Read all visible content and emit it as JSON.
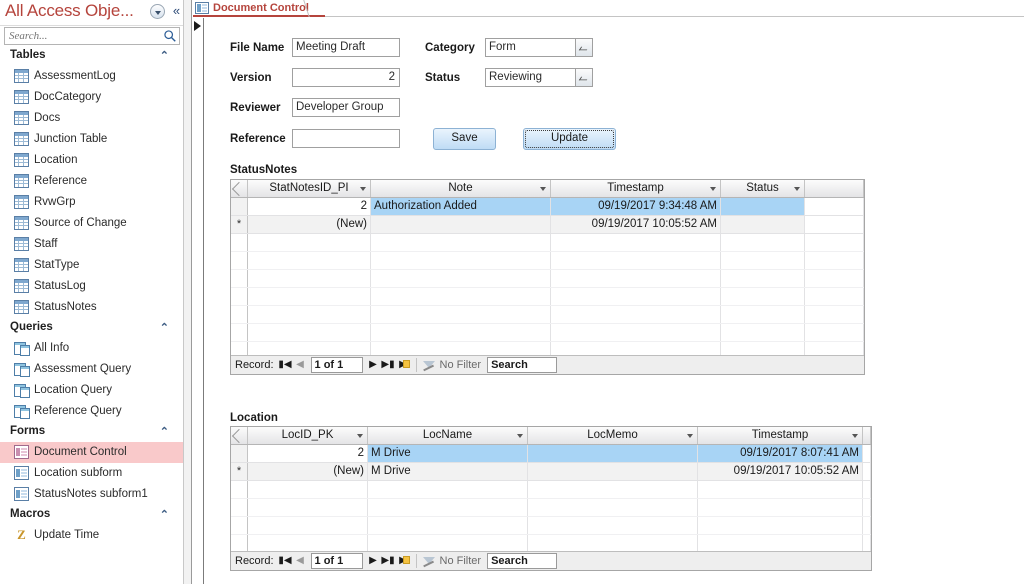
{
  "nav_pane": {
    "title": "All Access Obje...",
    "dropdown_icon": "chevron-down-circle-icon",
    "collapse_icon": "double-chevron-left-icon",
    "search_placeholder": "Search...",
    "search_value": "",
    "search_icon": "magnifier-icon",
    "groups": [
      {
        "label": "Tables",
        "collapse_icon": "chevron-up-icon",
        "icon_type": "table",
        "items": [
          "AssessmentLog",
          "DocCategory",
          "Docs",
          "Junction Table",
          "Location",
          "Reference",
          "RvwGrp",
          "Source of Change",
          "Staff",
          "StatType",
          "StatusLog",
          "StatusNotes"
        ]
      },
      {
        "label": "Queries",
        "collapse_icon": "chevron-up-icon",
        "icon_type": "query",
        "items": [
          "All Info",
          "Assessment Query",
          "Location Query",
          "Reference Query"
        ]
      },
      {
        "label": "Forms",
        "collapse_icon": "chevron-up-icon",
        "icon_type": "form",
        "items": [
          "Document Control",
          "Location subform",
          "StatusNotes subform1"
        ],
        "selected": "Document Control"
      },
      {
        "label": "Macros",
        "collapse_icon": "chevron-up-icon",
        "icon_type": "macro",
        "items": [
          "Update Time"
        ]
      }
    ]
  },
  "tab": {
    "label": "Document Control",
    "icon": "form-icon"
  },
  "form": {
    "fields": {
      "file_name_label": "File Name",
      "file_name_value": "Meeting Draft",
      "version_label": "Version",
      "version_value": "2",
      "reviewer_label": "Reviewer",
      "reviewer_value": "Developer Group",
      "reference_label": "Reference",
      "reference_value": "",
      "category_label": "Category",
      "category_value": "Form",
      "status_label": "Status",
      "status_value": "Reviewing"
    },
    "buttons": {
      "save": "Save",
      "update": "Update"
    }
  },
  "status_notes": {
    "title": "StatusNotes",
    "columns": [
      "StatNotesID_PI",
      "Note",
      "Timestamp",
      "Status"
    ],
    "rows": [
      {
        "selector": "",
        "id": "2",
        "note": "Authorization Added",
        "timestamp": "09/19/2017 9:34:48 AM",
        "status": "",
        "state": "selected"
      },
      {
        "selector": "*",
        "id": "(New)",
        "note": "",
        "timestamp": "09/19/2017 10:05:52 AM",
        "status": "",
        "state": "new"
      }
    ],
    "navbar": {
      "record_label": "Record:",
      "first_icon": "first-record-icon",
      "prev_icon": "previous-record-icon",
      "counter": "1 of 1",
      "next_icon": "next-record-icon",
      "last_icon": "last-record-icon",
      "new_icon": "new-record-icon",
      "filter_label": "No Filter",
      "filter_icon": "filter-icon",
      "search_value": "Search"
    }
  },
  "location": {
    "title": "Location",
    "columns": [
      "LocID_PK",
      "LocName",
      "LocMemo",
      "Timestamp"
    ],
    "rows": [
      {
        "selector": "",
        "id": "2",
        "name": "M Drive",
        "memo": "",
        "timestamp": "09/19/2017 8:07:41 AM",
        "state": "selected"
      },
      {
        "selector": "*",
        "id": "(New)",
        "name": "M Drive",
        "memo": "",
        "timestamp": "09/19/2017 10:05:52 AM",
        "state": "new"
      }
    ],
    "navbar": {
      "record_label": "Record:",
      "first_icon": "first-record-icon",
      "prev_icon": "previous-record-icon",
      "counter": "1 of 1",
      "next_icon": "next-record-icon",
      "last_icon": "last-record-icon",
      "new_icon": "new-record-icon",
      "filter_label": "No Filter",
      "filter_icon": "filter-icon",
      "search_value": "Search"
    }
  },
  "colors": {
    "accent_red": "#b5443c",
    "selected_row": "#a8d4f5",
    "selected_nav_item": "#f9c9ca"
  }
}
